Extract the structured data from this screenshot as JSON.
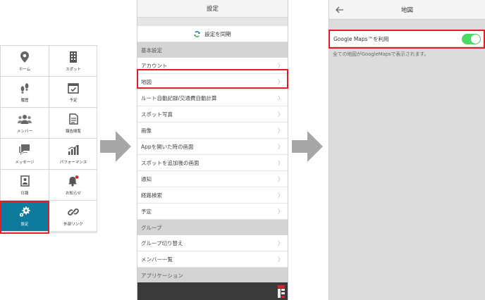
{
  "menu_grid": {
    "items": [
      {
        "label": "ホーム",
        "icon": "map-pin-icon"
      },
      {
        "label": "スポット",
        "icon": "building-icon"
      },
      {
        "label": "履歴",
        "icon": "footprints-icon"
      },
      {
        "label": "予定",
        "icon": "calendar-check-icon"
      },
      {
        "label": "メンバー",
        "icon": "people-icon"
      },
      {
        "label": "報告閲覧",
        "icon": "document-icon"
      },
      {
        "label": "メッセージ",
        "icon": "chat-icon"
      },
      {
        "label": "パフォーマンス",
        "icon": "bar-chart-icon"
      },
      {
        "label": "日報",
        "icon": "report-icon"
      },
      {
        "label": "お知らせ",
        "icon": "bell-icon"
      },
      {
        "label": "設定",
        "icon": "gear-icon"
      },
      {
        "label": "外部リンク",
        "icon": "link-icon"
      }
    ],
    "active_color": "#0e7a9c"
  },
  "settings_screen": {
    "title": "設定",
    "sync_label": "設定を同期",
    "section_basic": "基本設定",
    "basic_items": [
      "アカウント",
      "地図",
      "ルート自動記録/交通費自動計算",
      "スポット写真",
      "画像",
      "Appを開いた時の画面",
      "スポットを追加後の画面",
      "通知",
      "経路検索",
      "予定"
    ],
    "section_group": "グループ",
    "group_items": [
      "グループ切り替え",
      "メンバー一覧"
    ],
    "section_app": "アプリケーション"
  },
  "map_screen": {
    "title": "地図",
    "toggle_label": "Google Maps™を利用",
    "toggle_on": true,
    "description": "全ての地図がGoogleMapsで表示されます。"
  },
  "colors": {
    "highlight": "#e21d26",
    "accent": "#0e7a9c",
    "switch_on": "#4cd964"
  }
}
